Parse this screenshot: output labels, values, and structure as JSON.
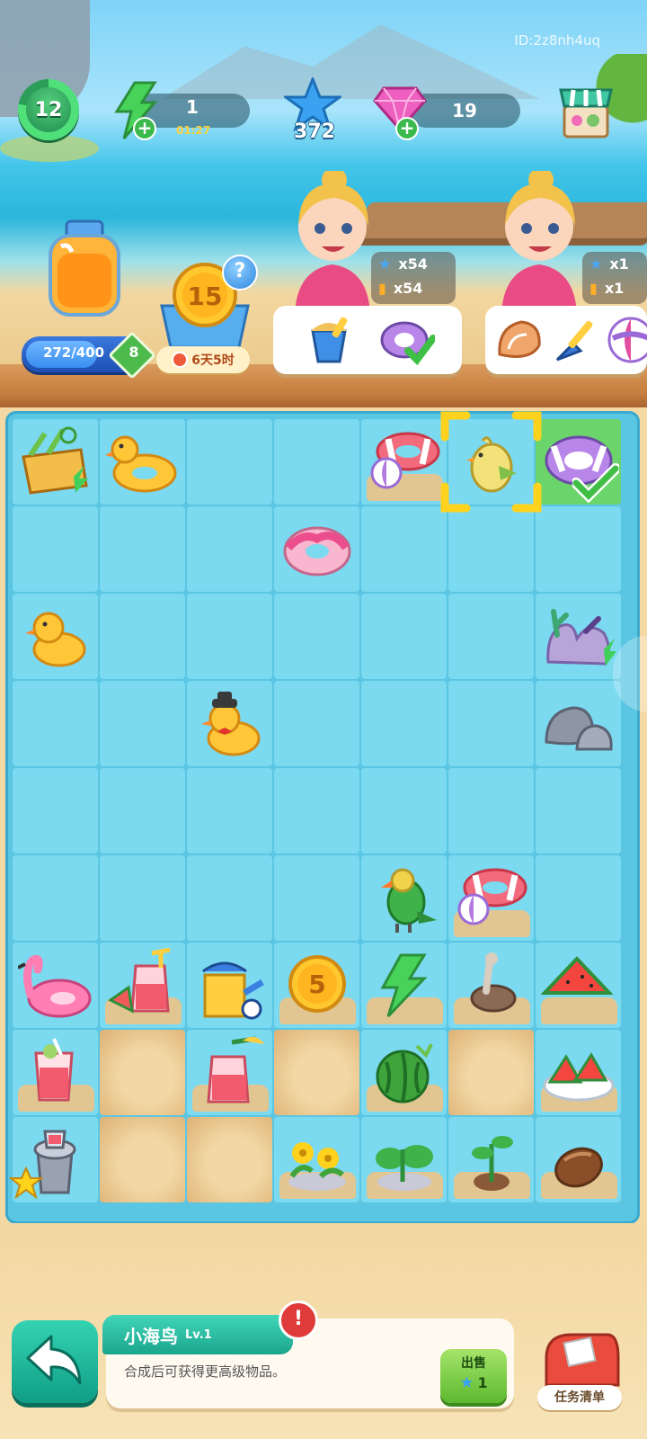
{
  "hud": {
    "id_label": "ID:2z8nh4uq",
    "level": "12",
    "energy": {
      "value": "1",
      "timer": "01:27"
    },
    "stars": "372",
    "gems": "19",
    "shop_icon": "shop-stall-icon"
  },
  "jar": {
    "progress_text": "272/400",
    "progress_fraction": 0.68,
    "badge": "8"
  },
  "event": {
    "coin_value": "15",
    "help": "?",
    "timer": "6天5时"
  },
  "orders": [
    {
      "req_star": "x54",
      "req_juice": "x54",
      "items": [
        "sand-bucket-icon",
        "swim-ring-icon"
      ]
    },
    {
      "req_star": "x1",
      "req_juice": "x1",
      "items": [
        "conch-shell-icon",
        "shovel-icon",
        "beach-ball-icon"
      ]
    }
  ],
  "board": {
    "cols": 7,
    "rows": 9,
    "cells": [
      "picnic-basket",
      "duck-float",
      "empty",
      "empty",
      "ball-ring-sand",
      "chick-selected",
      "ring-done",
      "empty",
      "empty",
      "empty",
      "donut-float",
      "empty",
      "empty",
      "empty",
      "empty-duck",
      "empty",
      "empty",
      "empty",
      "empty",
      "empty",
      "coral",
      "empty",
      "empty",
      "duck-hat",
      "empty",
      "empty",
      "empty",
      "rocks",
      "empty",
      "empty",
      "empty",
      "empty",
      "empty",
      "empty",
      "empty",
      "empty",
      "empty",
      "empty",
      "empty",
      "parrot",
      "ball-ring-sand",
      "empty",
      "flamingo",
      "juice-jug-sand",
      "watering-can",
      "coin5-sand",
      "energy-sand",
      "seabird-sand",
      "melon-slices-sand",
      "juice-glass-sand",
      "sand",
      "juice-jug-sand",
      "sand",
      "watermelon-sand",
      "sand",
      "melon-plate-sand",
      "juicer",
      "sand",
      "sand",
      "flowers-sand",
      "sprout-sand",
      "sapling-sand",
      "seed-sand"
    ],
    "coin_label": "5"
  },
  "selected": {
    "name": "小海鸟",
    "level": "Lv.1",
    "description": "合成后可获得更高级物品。",
    "sell_label": "出售",
    "sell_value": "1",
    "alert": "!"
  },
  "tasks_label": "任务清单",
  "colors": {
    "board": "#5bc6e3",
    "cell": "#7bd9f0",
    "accent": "#1aa58d",
    "energy": "#3ecf5a",
    "gem": "#e64fb2"
  }
}
